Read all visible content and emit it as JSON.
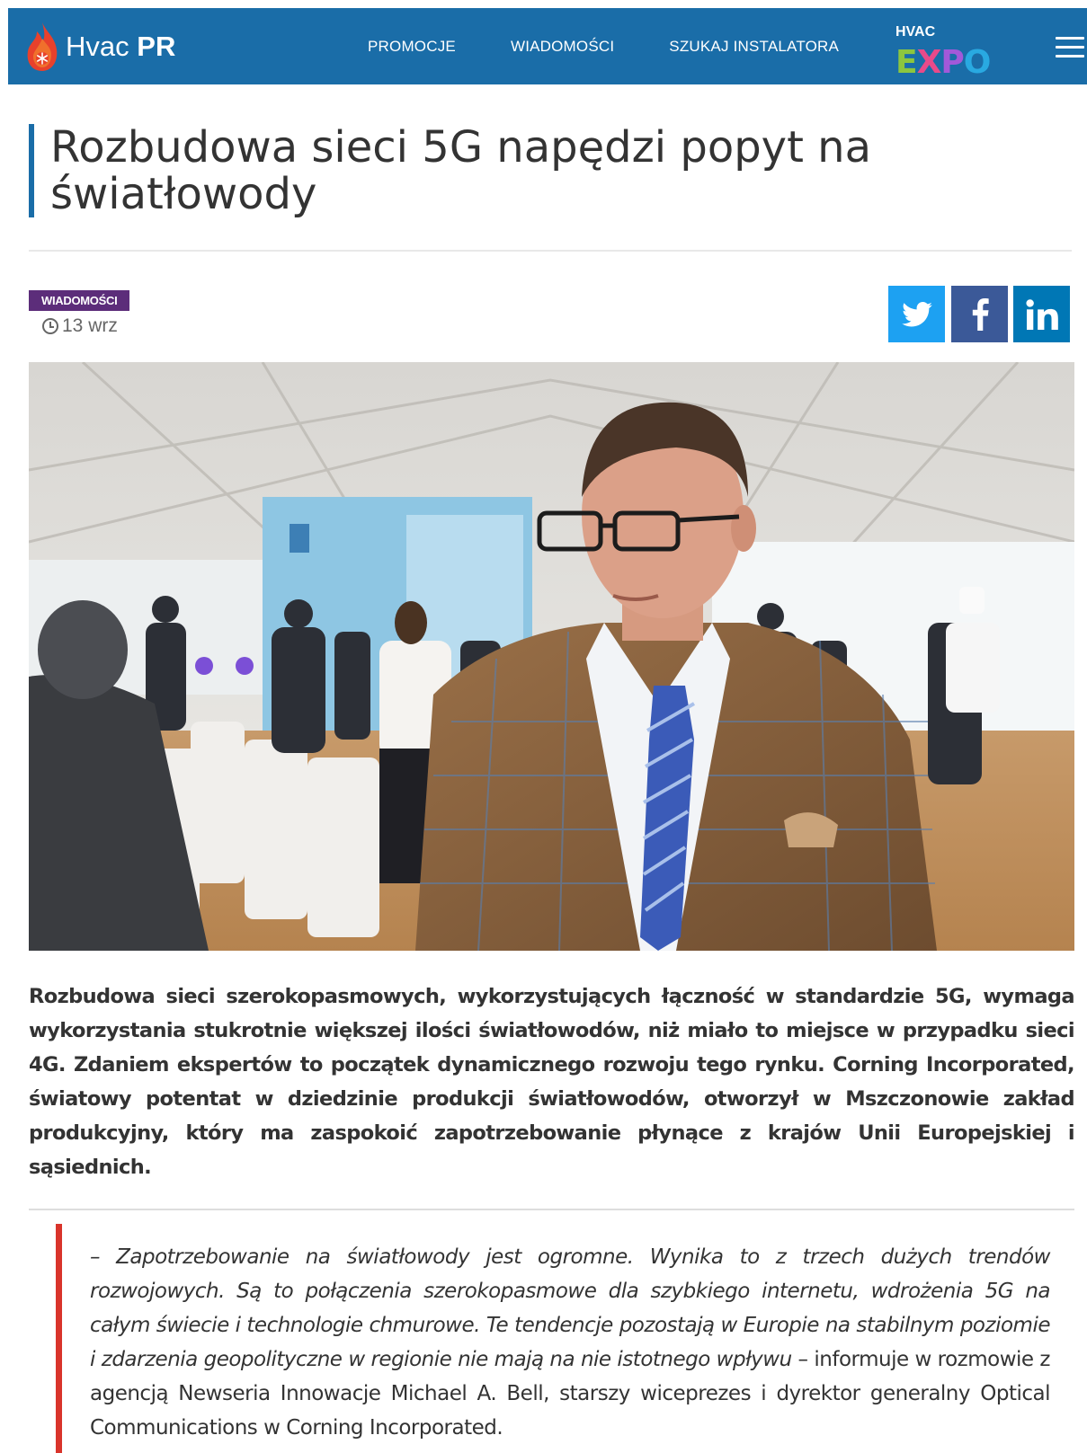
{
  "header": {
    "logo_text_light": "Hvac",
    "logo_text_bold": "PR",
    "nav": [
      "PROMOCJE",
      "WIADOMOŚCI",
      "SZUKAJ INSTALATORA"
    ],
    "expo_top": "HVAC",
    "expo_letters": [
      "E",
      "X",
      "P",
      "O"
    ]
  },
  "article": {
    "title": "Rozbudowa sieci 5G napędzi popyt na światłowody",
    "category": "WIADOMOŚCI",
    "date": "13 wrz",
    "lead": "Rozbudowa sieci szerokopasmowych, wykorzystujących łączność w standardzie 5G, wymaga wykorzystania stukrotnie większej ilości światłowodów, niż miało to miejsce w przypadku sieci 4G. Zdaniem ekspertów to początek dynamicznego rozwoju tego rynku. Corning Incorporated, światowy potentat w dziedzinie produkcji światłowodów, otworzył w Mszczonowie zakład produkcyjny, który ma zaspokoić zapotrzebowanie płynące z krajów Unii Europejskiej i sąsiednich.",
    "quote_italic": "– Zapotrzebowanie na światłowody jest ogromne. Wynika to z trzech dużych trendów rozwojowych. Są to połączenia szerokopasmowe dla szybkiego internetu, wdrożenia 5G na całym świecie i technologie chmurowe. Te tendencje pozostają w Europie na stabilnym poziomie i zdarzenia geopolityczne w regionie nie mają na nie istotnego wpływu",
    "quote_plain": " – informuje w rozmowie z agencją Newseria Innowacje Michael A. Bell, starszy wiceprezes i dyrektor generalny Optical Communications w Corning Incorporated."
  },
  "colors": {
    "header_bg": "#1a6da8",
    "category_bg": "#5c2d7a",
    "quote_bar": "#d9342b",
    "twitter": "#1da1f2",
    "facebook": "#3b5998",
    "linkedin": "#0077b5"
  },
  "icons": {
    "share": [
      "twitter-icon",
      "facebook-icon",
      "linkedin-icon"
    ],
    "date": "clock-icon",
    "menu": "hamburger-icon",
    "logo": "flame-snowflake-icon"
  }
}
